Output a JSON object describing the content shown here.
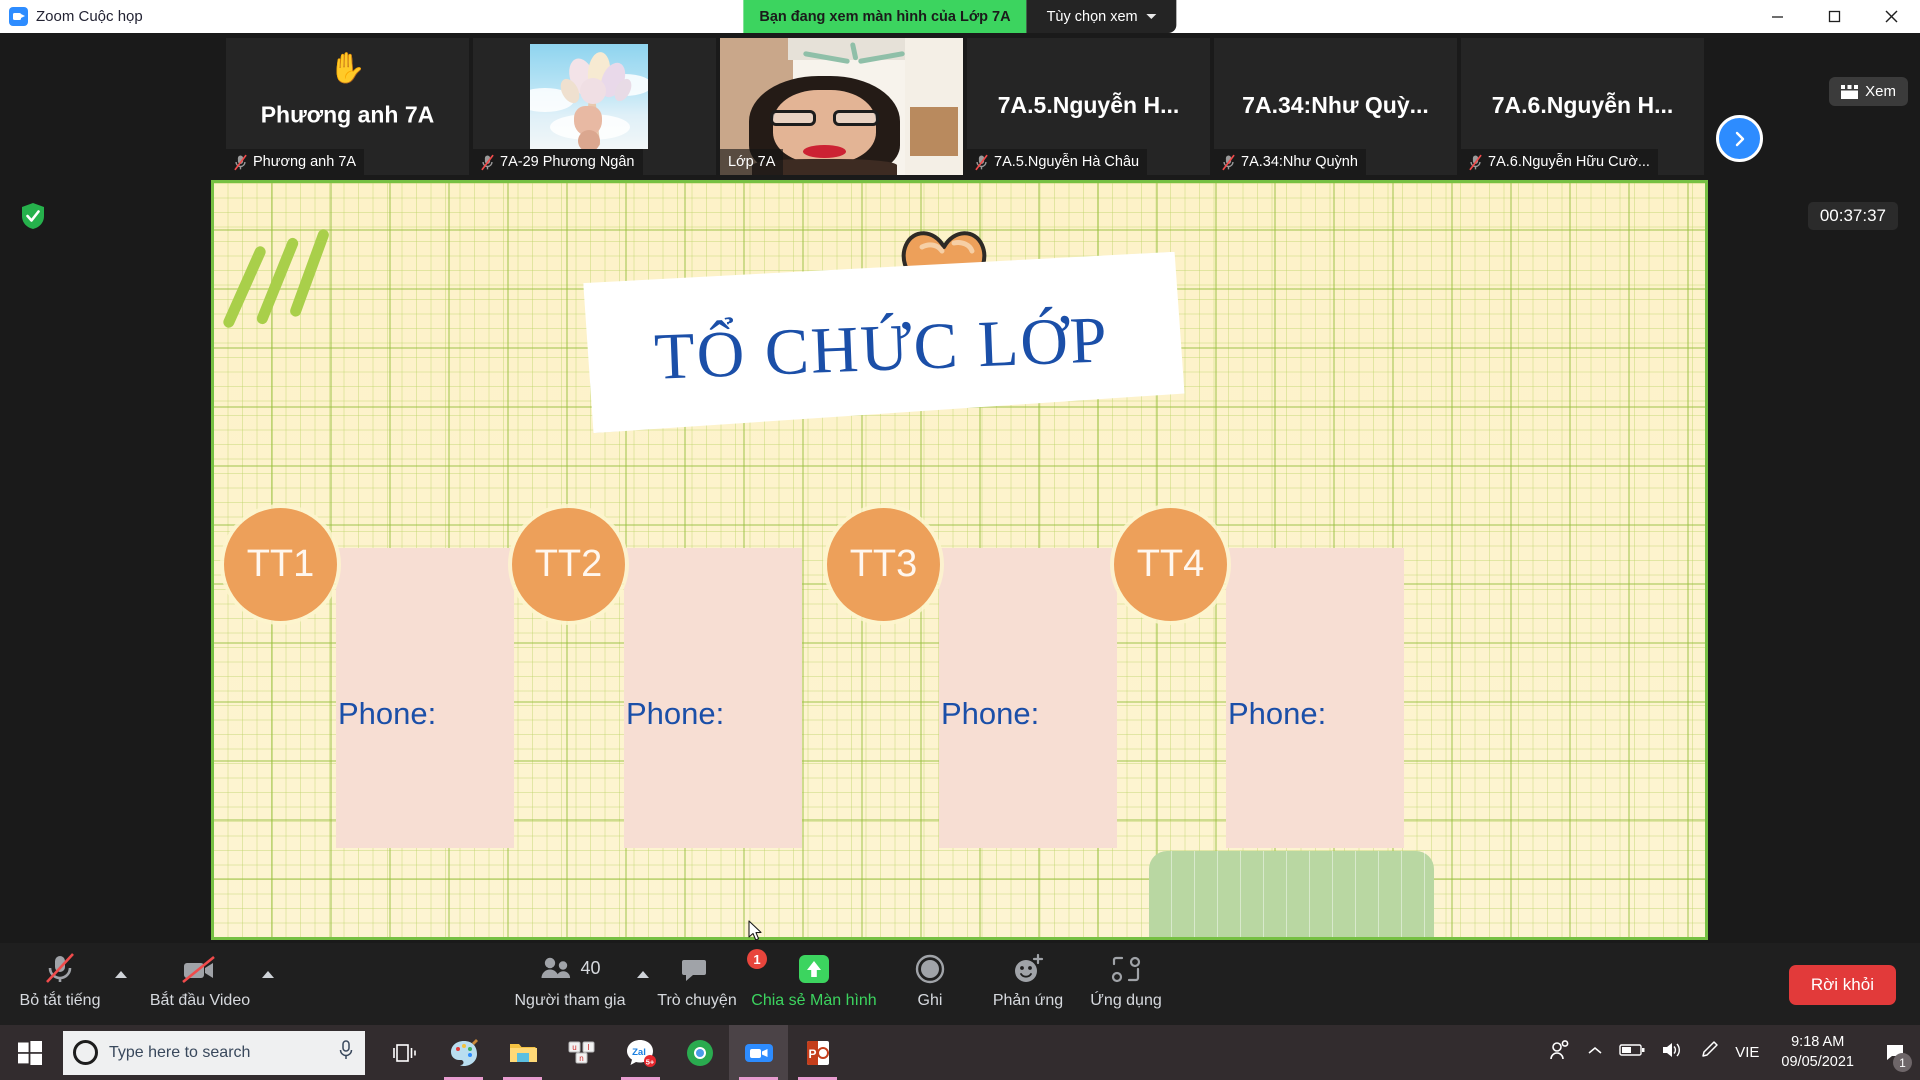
{
  "titlebar": {
    "app_title": "Zoom Cuộc họp",
    "app_icon": "zoom-logo-icon",
    "sharing_banner": "Bạn đang xem màn hình của Lớp 7A",
    "view_options_label": "Tùy chọn xem",
    "window_controls": {
      "minimize": "minimize-icon",
      "maximize": "maximize-icon",
      "close": "close-icon"
    }
  },
  "filmstrip": {
    "tiles": [
      {
        "big_name": "Phương anh 7A",
        "footer_name": "Phương anh 7A",
        "muted": true,
        "hand_raised": true,
        "active": false,
        "media": "none"
      },
      {
        "big_name": "",
        "footer_name": "7A-29 Phương Ngân",
        "muted": true,
        "hand_raised": false,
        "active": false,
        "media": "avatar-flowers"
      },
      {
        "big_name": "",
        "footer_name": "Lớp 7A",
        "muted": false,
        "hand_raised": false,
        "active": true,
        "media": "webcam"
      },
      {
        "big_name": "7A.5.Nguyễn  H...",
        "footer_name": "7A.5.Nguyễn Hà Châu",
        "muted": true,
        "hand_raised": false,
        "active": false,
        "media": "none"
      },
      {
        "big_name": "7A.34:Như  Quỳ...",
        "footer_name": "7A.34:Như Quỳnh",
        "muted": true,
        "hand_raised": false,
        "active": false,
        "media": "none"
      },
      {
        "big_name": "7A.6.Nguyễn  H...",
        "footer_name": "7A.6.Nguyễn Hữu Cườ...",
        "muted": true,
        "hand_raised": false,
        "active": false,
        "media": "none"
      }
    ],
    "next_arrow": "chevron-right-icon",
    "view_badge_label": "Xem",
    "view_badge_icon": "grid-view-icon"
  },
  "stage": {
    "security_icon": "shield-check-icon",
    "timer": "00:37:37",
    "slide": {
      "title": "TỔ CHỨC LỚP",
      "heart_icon": "heart-doodle-icon",
      "groups": [
        {
          "label": "TT1",
          "phone_label": "Phone:"
        },
        {
          "label": "TT2",
          "phone_label": "Phone:"
        },
        {
          "label": "TT3",
          "phone_label": "Phone:"
        },
        {
          "label": "TT4",
          "phone_label": "Phone:"
        }
      ],
      "colors": {
        "paper": "#fdf2c8",
        "grid": "#a9cf4a",
        "circle": "#eda05a",
        "box": "#f7ded3",
        "title_blue": "#1b4fa8",
        "border_green": "#76c043"
      }
    },
    "cursor": "mouse-pointer-icon"
  },
  "toolbar": {
    "items": [
      {
        "label": "Bỏ tắt tiếng",
        "icon": "microphone-muted-icon",
        "has_caret": true
      },
      {
        "label": "Bắt đầu Video",
        "icon": "video-muted-icon",
        "has_caret": true
      },
      {
        "label": "Người tham gia",
        "icon": "participants-icon",
        "count": "40",
        "has_caret": true
      },
      {
        "label": "Trò chuyện",
        "icon": "chat-icon",
        "badge": "1",
        "has_caret": false
      },
      {
        "label": "Chia sẻ Màn hình",
        "icon": "share-screen-icon",
        "has_caret": false,
        "active": true
      },
      {
        "label": "Ghi",
        "icon": "record-icon",
        "has_caret": false
      },
      {
        "label": "Phản ứng",
        "icon": "reactions-icon",
        "has_caret": false
      },
      {
        "label": "Ứng dụng",
        "icon": "apps-icon",
        "has_caret": false
      }
    ],
    "leave_button": "Rời khỏi",
    "accent_green": "#3cd45f",
    "leave_red": "#e23a3a"
  },
  "taskbar": {
    "start_icon": "windows-start-icon",
    "search_placeholder": "Type here to search",
    "search_value": "",
    "cortana_icon": "cortana-circle-icon",
    "mic_icon": "microphone-icon",
    "task_view_icon": "task-view-icon",
    "apps": [
      {
        "name": "paint-3d-icon",
        "running": true,
        "active": false
      },
      {
        "name": "file-explorer-icon",
        "running": true,
        "active": false
      },
      {
        "name": "unikey-icon",
        "running": false,
        "active": false
      },
      {
        "name": "zalo-icon",
        "running": true,
        "active": false,
        "badge": "5+"
      },
      {
        "name": "chrome-icon",
        "running": false,
        "active": false
      },
      {
        "name": "zoom-icon",
        "running": true,
        "active": true
      },
      {
        "name": "powerpoint-icon",
        "running": true,
        "active": false
      }
    ],
    "tray": {
      "people_icon": "people-icon",
      "show_hidden_icon": "chevron-up-icon",
      "battery_icon": "battery-icon",
      "volume_icon": "volume-icon",
      "pen_icon": "pen-icon",
      "language": "VIE",
      "time": "9:18 AM",
      "date": "09/05/2021",
      "notification_icon": "notifications-icon",
      "notification_count": "1"
    }
  }
}
